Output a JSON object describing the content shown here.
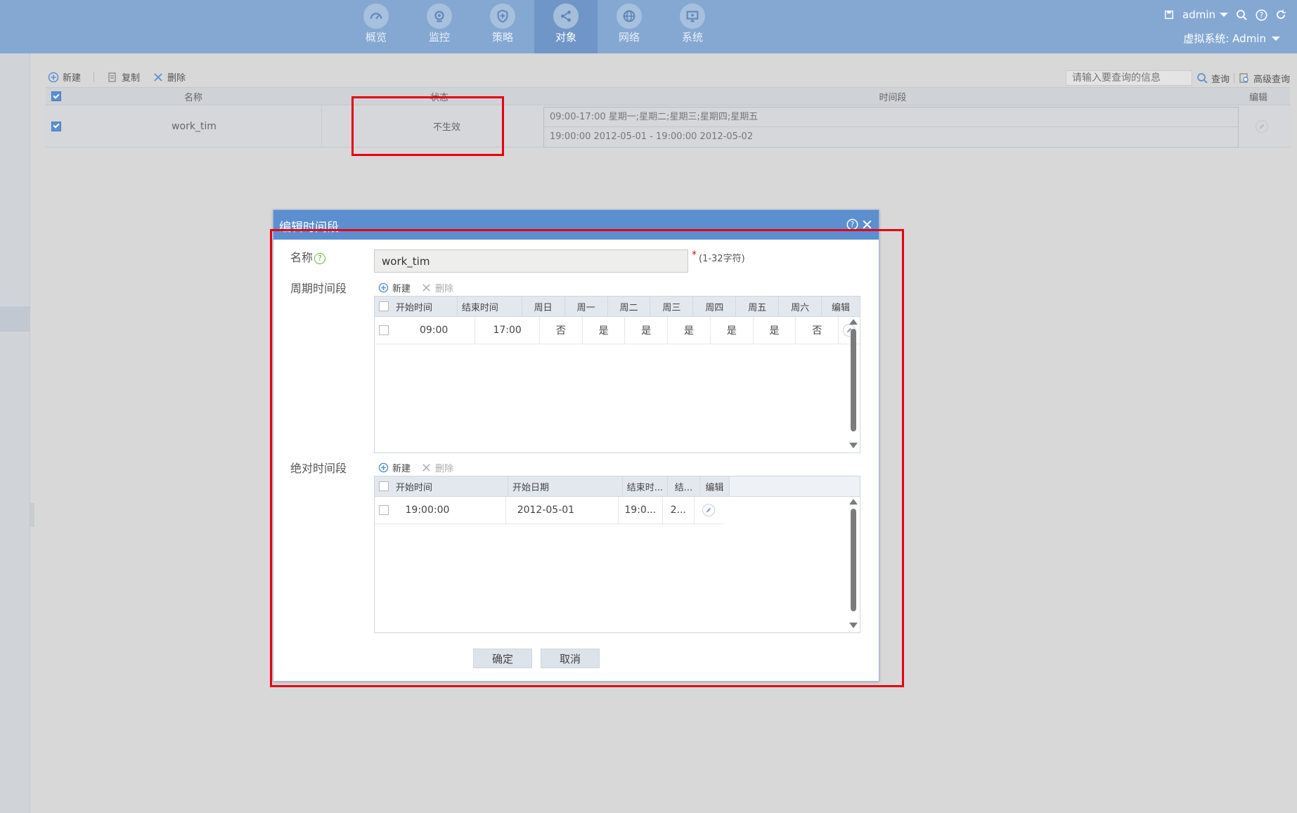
{
  "nav": {
    "items": [
      {
        "label": "概览",
        "icon": "gauge-icon"
      },
      {
        "label": "监控",
        "icon": "camera-icon"
      },
      {
        "label": "策略",
        "icon": "shield-icon"
      },
      {
        "label": "对象",
        "icon": "share-icon",
        "active": true
      },
      {
        "label": "网络",
        "icon": "globe-icon"
      },
      {
        "label": "系统",
        "icon": "monitor-icon"
      }
    ]
  },
  "user": {
    "name": "admin",
    "vsys_label": "虚拟系统: Admin"
  },
  "toolbar": {
    "new_label": "新建",
    "copy_label": "复制",
    "delete_label": "删除"
  },
  "search": {
    "placeholder": "请输入要查询的信息",
    "query_label": "查询",
    "advanced_label": "高级查询"
  },
  "grid": {
    "headers": {
      "name": "名称",
      "status": "状态",
      "period": "时间段",
      "edit": "编辑"
    },
    "rows": [
      {
        "name": "work_tim",
        "status": "不生效",
        "periods": [
          "09:00-17:00 星期一;星期二;星期三;星期四;星期五",
          "19:00:00 2012-05-01 - 19:00:00 2012-05-02"
        ]
      }
    ]
  },
  "dialog": {
    "title": "编辑时间段",
    "name_label": "名称",
    "name_value": "work_tim",
    "required_mark": "*",
    "name_hint": "(1-32字符)",
    "periodic_label": "周期时间段",
    "absolute_label": "绝对时间段",
    "new_label": "新建",
    "delete_label": "删除",
    "periodic": {
      "headers": [
        "开始时间",
        "结束时间",
        "周日",
        "周一",
        "周二",
        "周三",
        "周四",
        "周五",
        "周六",
        "编辑"
      ],
      "rows": [
        {
          "start": "09:00",
          "end": "17:00",
          "sun": "否",
          "mon": "是",
          "tue": "是",
          "wed": "是",
          "thu": "是",
          "fri": "是",
          "sat": "否"
        }
      ]
    },
    "absolute": {
      "headers": [
        "开始时间",
        "开始日期",
        "结束时...",
        "结...",
        "编辑"
      ],
      "rows": [
        {
          "start_time": "19:00:00",
          "start_date": "2012-05-01",
          "end_time": "19:0...",
          "end_date": "2..."
        }
      ]
    },
    "ok_label": "确定",
    "cancel_label": "取消"
  },
  "colors": {
    "topbar": "#85a8d2",
    "dialog_title": "#5b8fd0",
    "highlight": "#e60012"
  }
}
